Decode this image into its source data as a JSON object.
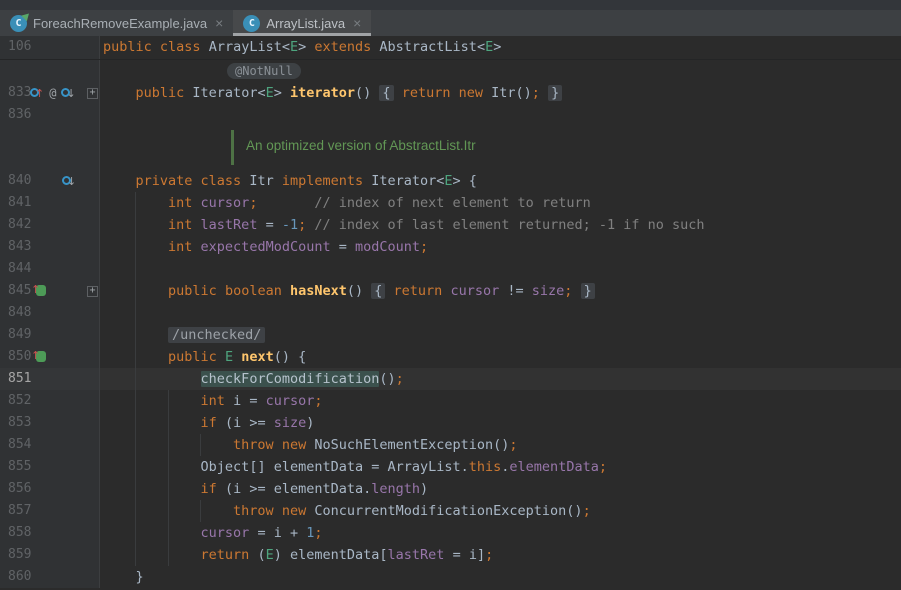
{
  "colors": {
    "editor_bg": "#2B2B2B",
    "gutter_bg": "#303234",
    "tabbar_bg": "#3D4043",
    "active_tab_bg": "#47494B",
    "active_tab_underline": "#A0A3A6",
    "keyword": "#CC7832",
    "field": "#9876AA",
    "method": "#FFC66D",
    "number": "#6897BB",
    "comment": "#808080",
    "type_param": "#4EA57F",
    "doc_comment": "#629755",
    "current_line": "#323232",
    "identifier_highlight": "#3B514D"
  },
  "tabs": [
    {
      "label": "ForeachRemoveExample.java",
      "icon_letter": "C",
      "close": "×",
      "active": false,
      "runnable": true
    },
    {
      "label": "ArrayList.java",
      "icon_letter": "C",
      "close": "×",
      "active": true,
      "runnable": false
    }
  ],
  "sticky_header": {
    "line_no": "106",
    "segs": [
      [
        "k",
        "public "
      ],
      [
        "k",
        "class "
      ],
      [
        "t",
        "ArrayList<"
      ],
      [
        "tp",
        "E"
      ],
      [
        "t",
        "> "
      ],
      [
        "k",
        "extends "
      ],
      [
        "t",
        "AbstractList<"
      ],
      [
        "tp",
        "E"
      ],
      [
        "t",
        ">"
      ]
    ]
  },
  "hint_label": "@NotNull",
  "doc_comment_text": "An optimized version of AbstractList.Itr",
  "lines": [
    {
      "kind": "hint",
      "num": ""
    },
    {
      "kind": "code",
      "num": "833",
      "ind": 4,
      "icons": [
        "override-up",
        "annotation",
        "overridden-down"
      ],
      "iconX": 30,
      "fold": "plus",
      "segs": [
        [
          "k",
          "public "
        ],
        [
          "t",
          "Iterator<"
        ],
        [
          "tp",
          "E"
        ],
        [
          "t",
          "> "
        ],
        [
          "m",
          "iterator"
        ],
        [
          "t",
          "() "
        ],
        [
          "fold",
          "{"
        ],
        [
          "t",
          " "
        ],
        [
          "k",
          "return"
        ],
        [
          "t",
          " "
        ],
        [
          "k",
          "new"
        ],
        [
          "t",
          " Itr()"
        ],
        [
          "semi",
          ";"
        ],
        [
          "t",
          " "
        ],
        [
          "fold",
          "}"
        ]
      ]
    },
    {
      "kind": "blank",
      "num": "836"
    },
    {
      "kind": "doc",
      "num": "",
      "h": 44
    },
    {
      "kind": "code",
      "num": "840",
      "ind": 4,
      "icons": [
        "overridden-down"
      ],
      "iconX": 62,
      "fold": "open",
      "segs": [
        [
          "k",
          "private "
        ],
        [
          "k",
          "class "
        ],
        [
          "t",
          "Itr "
        ],
        [
          "k",
          "implements "
        ],
        [
          "t",
          "Iterator<"
        ],
        [
          "tp",
          "E"
        ],
        [
          "t",
          "> {"
        ]
      ]
    },
    {
      "kind": "code",
      "num": "841",
      "ind": 8,
      "segs": [
        [
          "k",
          "int "
        ],
        [
          "f",
          "cursor"
        ],
        [
          "semi",
          ";"
        ],
        [
          "c",
          "       // index of next element to return"
        ]
      ]
    },
    {
      "kind": "code",
      "num": "842",
      "ind": 8,
      "segs": [
        [
          "k",
          "int "
        ],
        [
          "f",
          "lastRet"
        ],
        [
          "t",
          " = "
        ],
        [
          "n",
          "-1"
        ],
        [
          "semi",
          ";"
        ],
        [
          "c",
          " // index of last element returned; -1 if no such"
        ]
      ]
    },
    {
      "kind": "code",
      "num": "843",
      "ind": 8,
      "segs": [
        [
          "k",
          "int "
        ],
        [
          "f",
          "expectedModCount"
        ],
        [
          "t",
          " = "
        ],
        [
          "f",
          "modCount"
        ],
        [
          "semi",
          ";"
        ]
      ]
    },
    {
      "kind": "blank",
      "num": "844"
    },
    {
      "kind": "code",
      "num": "845",
      "ind": 8,
      "icons": [
        "overriding"
      ],
      "iconX": 33,
      "fold": "plus",
      "segs": [
        [
          "k",
          "public "
        ],
        [
          "k",
          "boolean "
        ],
        [
          "m",
          "hasNext"
        ],
        [
          "t",
          "() "
        ],
        [
          "fold",
          "{"
        ],
        [
          "t",
          " "
        ],
        [
          "k",
          "return"
        ],
        [
          "t",
          " "
        ],
        [
          "f",
          "cursor"
        ],
        [
          "t",
          " != "
        ],
        [
          "f",
          "size"
        ],
        [
          "semi",
          ";"
        ],
        [
          "t",
          " "
        ],
        [
          "fold",
          "}"
        ]
      ]
    },
    {
      "kind": "blank",
      "num": "848"
    },
    {
      "kind": "code",
      "num": "849",
      "ind": 8,
      "segs": [
        [
          "foldc",
          "/unchecked/"
        ]
      ]
    },
    {
      "kind": "code",
      "num": "850",
      "ind": 8,
      "icons": [
        "overriding"
      ],
      "iconX": 33,
      "fold": "open",
      "segs": [
        [
          "k",
          "public "
        ],
        [
          "tp",
          "E"
        ],
        [
          "t",
          " "
        ],
        [
          "m",
          "next"
        ],
        [
          "t",
          "() {"
        ]
      ]
    },
    {
      "kind": "code",
      "num": "851",
      "ind": 12,
      "current": true,
      "segs": [
        [
          "hl",
          "checkForComodification"
        ],
        [
          "t",
          "()"
        ],
        [
          "semi",
          ";"
        ]
      ]
    },
    {
      "kind": "code",
      "num": "852",
      "ind": 12,
      "segs": [
        [
          "k",
          "int "
        ],
        [
          "t",
          "i = "
        ],
        [
          "f",
          "cursor"
        ],
        [
          "semi",
          ";"
        ]
      ]
    },
    {
      "kind": "code",
      "num": "853",
      "ind": 12,
      "segs": [
        [
          "k",
          "if "
        ],
        [
          "t",
          "(i >= "
        ],
        [
          "f",
          "size"
        ],
        [
          "t",
          ")"
        ]
      ]
    },
    {
      "kind": "code",
      "num": "854",
      "ind": 16,
      "segs": [
        [
          "k",
          "throw "
        ],
        [
          "k",
          "new "
        ],
        [
          "t",
          "NoSuchElementException()"
        ],
        [
          "semi",
          ";"
        ]
      ]
    },
    {
      "kind": "code",
      "num": "855",
      "ind": 12,
      "segs": [
        [
          "t",
          "Object[] elementData = ArrayList."
        ],
        [
          "k",
          "this"
        ],
        [
          "t",
          "."
        ],
        [
          "f",
          "elementData"
        ],
        [
          "semi",
          ";"
        ]
      ]
    },
    {
      "kind": "code",
      "num": "856",
      "ind": 12,
      "segs": [
        [
          "k",
          "if "
        ],
        [
          "t",
          "(i >= elementData."
        ],
        [
          "f",
          "length"
        ],
        [
          "t",
          ")"
        ]
      ]
    },
    {
      "kind": "code",
      "num": "857",
      "ind": 16,
      "segs": [
        [
          "k",
          "throw "
        ],
        [
          "k",
          "new "
        ],
        [
          "t",
          "ConcurrentModificationException()"
        ],
        [
          "semi",
          ";"
        ]
      ]
    },
    {
      "kind": "code",
      "num": "858",
      "ind": 12,
      "segs": [
        [
          "f",
          "cursor"
        ],
        [
          "t",
          " = i + "
        ],
        [
          "n",
          "1"
        ],
        [
          "semi",
          ";"
        ]
      ]
    },
    {
      "kind": "code",
      "num": "859",
      "ind": 12,
      "segs": [
        [
          "k",
          "return "
        ],
        [
          "t",
          "("
        ],
        [
          "tp",
          "E"
        ],
        [
          "t",
          ") elementData["
        ],
        [
          "f",
          "lastRet"
        ],
        [
          "t",
          " = i]"
        ],
        [
          "semi",
          ";"
        ]
      ]
    },
    {
      "kind": "code",
      "num": "860",
      "ind": 4,
      "fold": "close",
      "segs": [
        [
          "t",
          "}"
        ]
      ]
    }
  ]
}
